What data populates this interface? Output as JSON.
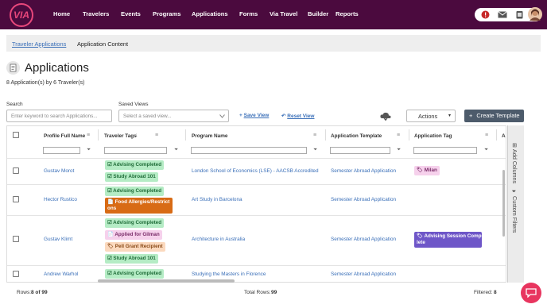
{
  "nav": {
    "logo_text": "VIA",
    "items": [
      "Home",
      "Travelers",
      "Events",
      "Programs",
      "Applications",
      "Forms",
      "Via Travel",
      "Builder",
      "Reports"
    ]
  },
  "breadcrumb": {
    "link": "Traveler Applications",
    "current": "Application Content"
  },
  "page": {
    "title": "Applications",
    "count": "8 Application(s) by 6 Traveler(s)"
  },
  "search": {
    "label": "Search",
    "placeholder": "Enter keyword to search Applications..."
  },
  "saved_views": {
    "label": "Saved Views",
    "placeholder": "Select a saved view..."
  },
  "links": {
    "save_view": "Save View",
    "reset_view": "Reset View"
  },
  "actions_label": "Actions",
  "create_label": "Create Template",
  "columns": [
    "Profile Full Name",
    "Traveler Tags",
    "Program Name",
    "Application Template",
    "Application Tag",
    "Ap"
  ],
  "rows": [
    {
      "name": "Gustav Morot",
      "program": "London School of Economics (LSE) - AACSB Accredited",
      "template": "Semester Abroad Application"
    },
    {
      "name": "Hector Rustico",
      "program": "Art Study in Barcelona",
      "template": "Semester Abroad Application"
    },
    {
      "name": "Gustav Klimt",
      "program": "Architecture in Australia",
      "template": "Semester Abroad Application"
    },
    {
      "name": "Andrew Warhol",
      "program": "Studying the Masters in Florence",
      "template": "Semester Abroad Application"
    }
  ],
  "tags": {
    "advising_completed": "☑ Advising Completed",
    "study_abroad": "☑ Study Abroad 101",
    "food_1": "📄 Food Allergies/Restrict",
    "food_2": "ons",
    "applied_gilman": "📄 Applied for Gilman",
    "pell_grant": "🏷 Pell Grant Recipient",
    "milan": "🏷 Milan",
    "advising_session_1": "🏷 Advising Session Comp",
    "advising_session_2": "lete"
  },
  "side_panel": {
    "add_columns": "Add Columns",
    "custom_filters": "Custom Filters"
  },
  "footer": {
    "rows_label": "Rows:",
    "rows_value": "8 of 99",
    "total_label": "Total Rows:",
    "total_value": "99",
    "filtered_label": "Filtered:",
    "filtered_value": "8"
  },
  "colors": {
    "nav_bg": "#4b0a3e",
    "accent": "#e8477b",
    "link": "#3a6fb8",
    "primary_btn": "#4d5b6b",
    "chat": "#e8355f"
  },
  "icons": [
    "alert-icon",
    "mail-icon",
    "tablet-icon",
    "avatar",
    "cloud-download-icon",
    "document-icon",
    "chat-icon",
    "funnel-icon",
    "menu-icon",
    "sort-down-icon"
  ]
}
